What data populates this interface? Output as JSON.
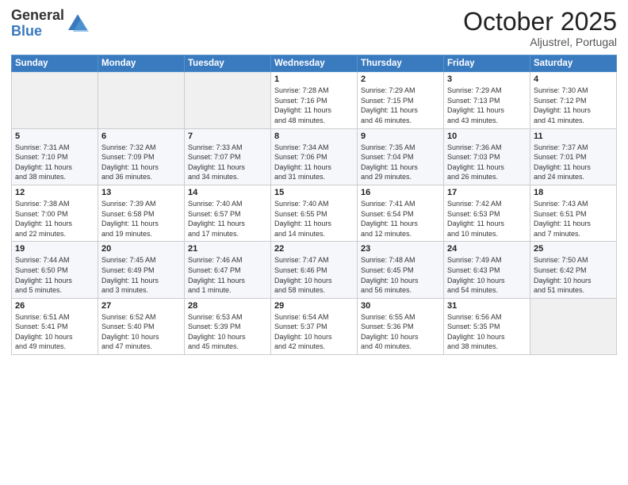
{
  "header": {
    "logo_general": "General",
    "logo_blue": "Blue",
    "month": "October 2025",
    "location": "Aljustrel, Portugal"
  },
  "weekdays": [
    "Sunday",
    "Monday",
    "Tuesday",
    "Wednesday",
    "Thursday",
    "Friday",
    "Saturday"
  ],
  "weeks": [
    [
      {
        "day": "",
        "info": ""
      },
      {
        "day": "",
        "info": ""
      },
      {
        "day": "",
        "info": ""
      },
      {
        "day": "1",
        "info": "Sunrise: 7:28 AM\nSunset: 7:16 PM\nDaylight: 11 hours\nand 48 minutes."
      },
      {
        "day": "2",
        "info": "Sunrise: 7:29 AM\nSunset: 7:15 PM\nDaylight: 11 hours\nand 46 minutes."
      },
      {
        "day": "3",
        "info": "Sunrise: 7:29 AM\nSunset: 7:13 PM\nDaylight: 11 hours\nand 43 minutes."
      },
      {
        "day": "4",
        "info": "Sunrise: 7:30 AM\nSunset: 7:12 PM\nDaylight: 11 hours\nand 41 minutes."
      }
    ],
    [
      {
        "day": "5",
        "info": "Sunrise: 7:31 AM\nSunset: 7:10 PM\nDaylight: 11 hours\nand 38 minutes."
      },
      {
        "day": "6",
        "info": "Sunrise: 7:32 AM\nSunset: 7:09 PM\nDaylight: 11 hours\nand 36 minutes."
      },
      {
        "day": "7",
        "info": "Sunrise: 7:33 AM\nSunset: 7:07 PM\nDaylight: 11 hours\nand 34 minutes."
      },
      {
        "day": "8",
        "info": "Sunrise: 7:34 AM\nSunset: 7:06 PM\nDaylight: 11 hours\nand 31 minutes."
      },
      {
        "day": "9",
        "info": "Sunrise: 7:35 AM\nSunset: 7:04 PM\nDaylight: 11 hours\nand 29 minutes."
      },
      {
        "day": "10",
        "info": "Sunrise: 7:36 AM\nSunset: 7:03 PM\nDaylight: 11 hours\nand 26 minutes."
      },
      {
        "day": "11",
        "info": "Sunrise: 7:37 AM\nSunset: 7:01 PM\nDaylight: 11 hours\nand 24 minutes."
      }
    ],
    [
      {
        "day": "12",
        "info": "Sunrise: 7:38 AM\nSunset: 7:00 PM\nDaylight: 11 hours\nand 22 minutes."
      },
      {
        "day": "13",
        "info": "Sunrise: 7:39 AM\nSunset: 6:58 PM\nDaylight: 11 hours\nand 19 minutes."
      },
      {
        "day": "14",
        "info": "Sunrise: 7:40 AM\nSunset: 6:57 PM\nDaylight: 11 hours\nand 17 minutes."
      },
      {
        "day": "15",
        "info": "Sunrise: 7:40 AM\nSunset: 6:55 PM\nDaylight: 11 hours\nand 14 minutes."
      },
      {
        "day": "16",
        "info": "Sunrise: 7:41 AM\nSunset: 6:54 PM\nDaylight: 11 hours\nand 12 minutes."
      },
      {
        "day": "17",
        "info": "Sunrise: 7:42 AM\nSunset: 6:53 PM\nDaylight: 11 hours\nand 10 minutes."
      },
      {
        "day": "18",
        "info": "Sunrise: 7:43 AM\nSunset: 6:51 PM\nDaylight: 11 hours\nand 7 minutes."
      }
    ],
    [
      {
        "day": "19",
        "info": "Sunrise: 7:44 AM\nSunset: 6:50 PM\nDaylight: 11 hours\nand 5 minutes."
      },
      {
        "day": "20",
        "info": "Sunrise: 7:45 AM\nSunset: 6:49 PM\nDaylight: 11 hours\nand 3 minutes."
      },
      {
        "day": "21",
        "info": "Sunrise: 7:46 AM\nSunset: 6:47 PM\nDaylight: 11 hours\nand 1 minute."
      },
      {
        "day": "22",
        "info": "Sunrise: 7:47 AM\nSunset: 6:46 PM\nDaylight: 10 hours\nand 58 minutes."
      },
      {
        "day": "23",
        "info": "Sunrise: 7:48 AM\nSunset: 6:45 PM\nDaylight: 10 hours\nand 56 minutes."
      },
      {
        "day": "24",
        "info": "Sunrise: 7:49 AM\nSunset: 6:43 PM\nDaylight: 10 hours\nand 54 minutes."
      },
      {
        "day": "25",
        "info": "Sunrise: 7:50 AM\nSunset: 6:42 PM\nDaylight: 10 hours\nand 51 minutes."
      }
    ],
    [
      {
        "day": "26",
        "info": "Sunrise: 6:51 AM\nSunset: 5:41 PM\nDaylight: 10 hours\nand 49 minutes."
      },
      {
        "day": "27",
        "info": "Sunrise: 6:52 AM\nSunset: 5:40 PM\nDaylight: 10 hours\nand 47 minutes."
      },
      {
        "day": "28",
        "info": "Sunrise: 6:53 AM\nSunset: 5:39 PM\nDaylight: 10 hours\nand 45 minutes."
      },
      {
        "day": "29",
        "info": "Sunrise: 6:54 AM\nSunset: 5:37 PM\nDaylight: 10 hours\nand 42 minutes."
      },
      {
        "day": "30",
        "info": "Sunrise: 6:55 AM\nSunset: 5:36 PM\nDaylight: 10 hours\nand 40 minutes."
      },
      {
        "day": "31",
        "info": "Sunrise: 6:56 AM\nSunset: 5:35 PM\nDaylight: 10 hours\nand 38 minutes."
      },
      {
        "day": "",
        "info": ""
      }
    ]
  ]
}
